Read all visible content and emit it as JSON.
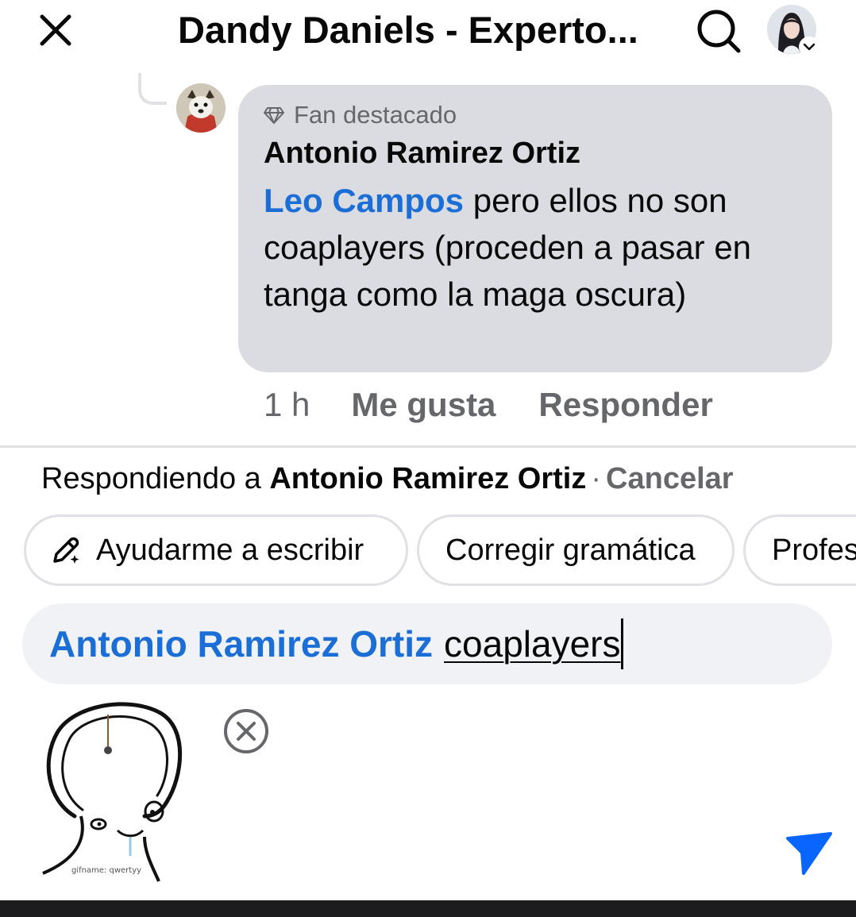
{
  "header": {
    "title": "Dandy Daniels - Experto...",
    "icons": {
      "close": "close-icon",
      "search": "search-icon",
      "profile": "profile-avatar",
      "chevron": "chevron-down-icon"
    }
  },
  "comment": {
    "badge": "Fan destacado",
    "author": "Antonio Ramirez Ortiz",
    "mention": "Leo Campos",
    "text": " pero ellos no son coaplayers (proceden a pasar en tanga como la maga oscura)",
    "time": "1 h",
    "like_label": "Me gusta",
    "reply_label": "Responder"
  },
  "reply": {
    "prefix": "Respondiendo a ",
    "to": "Antonio Ramirez Ortiz",
    "separator": "·",
    "cancel_label": "Cancelar"
  },
  "chips": [
    "Ayudarme a escribir",
    "Corregir gramática",
    "Profes"
  ],
  "input": {
    "mention": "Antonio Ramirez Ortiz",
    "typed": "coaplayers"
  },
  "gif": {
    "watermark": "gifname: qwertyy"
  },
  "colors": {
    "accent_blue": "#1b6ed6",
    "send_blue": "#0866ff",
    "bubble_bg": "#dadce1",
    "muted_text": "#65676b",
    "input_bg": "#f0f2f5"
  }
}
